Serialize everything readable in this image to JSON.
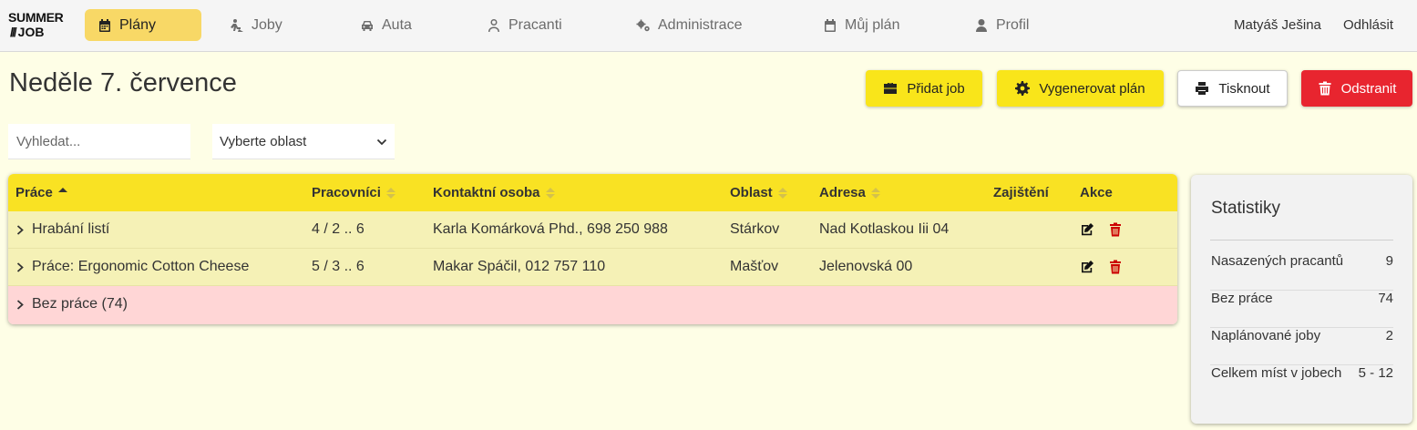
{
  "brand": {
    "line1": "SUMMER",
    "line2": "JOB",
    "stripes": "///"
  },
  "nav": {
    "items": [
      {
        "label": "Plány",
        "icon": "calendar-icon",
        "active": true
      },
      {
        "label": "Joby",
        "icon": "worker-icon"
      },
      {
        "label": "Auta",
        "icon": "car-icon"
      },
      {
        "label": "Pracanti",
        "icon": "user-outline-icon"
      },
      {
        "label": "Administrace",
        "icon": "gears-icon"
      },
      {
        "label": "Můj plán",
        "icon": "calendar-icon"
      },
      {
        "label": "Profil",
        "icon": "user-icon"
      }
    ],
    "user_name": "Matyáš Ješina",
    "logout": "Odhlásit"
  },
  "page": {
    "title": "Neděle 7. července",
    "buttons": {
      "add_job": "Přidat job",
      "generate": "Vygenerovat plán",
      "print": "Tisknout",
      "delete": "Odstranit"
    },
    "search_placeholder": "Vyhledat...",
    "area_select": "Vyberte oblast"
  },
  "table": {
    "columns": [
      "Práce",
      "Pracovníci",
      "Kontaktní osoba",
      "Oblast",
      "Adresa",
      "Zajištění",
      "Akce"
    ],
    "rows": [
      {
        "job": "Hrabání listí",
        "workers": "4 / 2 .. 6",
        "contact": "Karla Komárková Phd., 698 250 988",
        "area": "Stárkov",
        "address": "Nad Kotlaskou Iii 04",
        "secured": ""
      },
      {
        "job": "Práce: Ergonomic Cotton Cheese",
        "workers": "5 / 3 .. 6",
        "contact": "Makar Spáčil, 012 757 110",
        "area": "Mašťov",
        "address": "Jelenovská 00",
        "secured": ""
      }
    ],
    "no_job_row": "Bez práce (74)"
  },
  "stats": {
    "title": "Statistiky",
    "items": [
      {
        "label": "Nasazených pracantů",
        "value": "9"
      },
      {
        "label": "Bez práce",
        "value": "74"
      },
      {
        "label": "Naplánované joby",
        "value": "2"
      },
      {
        "label": "Celkem míst v jobech",
        "value": "5 - 12"
      }
    ]
  },
  "colors": {
    "accent": "#f9e51a",
    "danger": "#e8252f",
    "background": "#fefee6",
    "row": "#f5f1b6",
    "row_unassigned": "#ffd6d6"
  }
}
